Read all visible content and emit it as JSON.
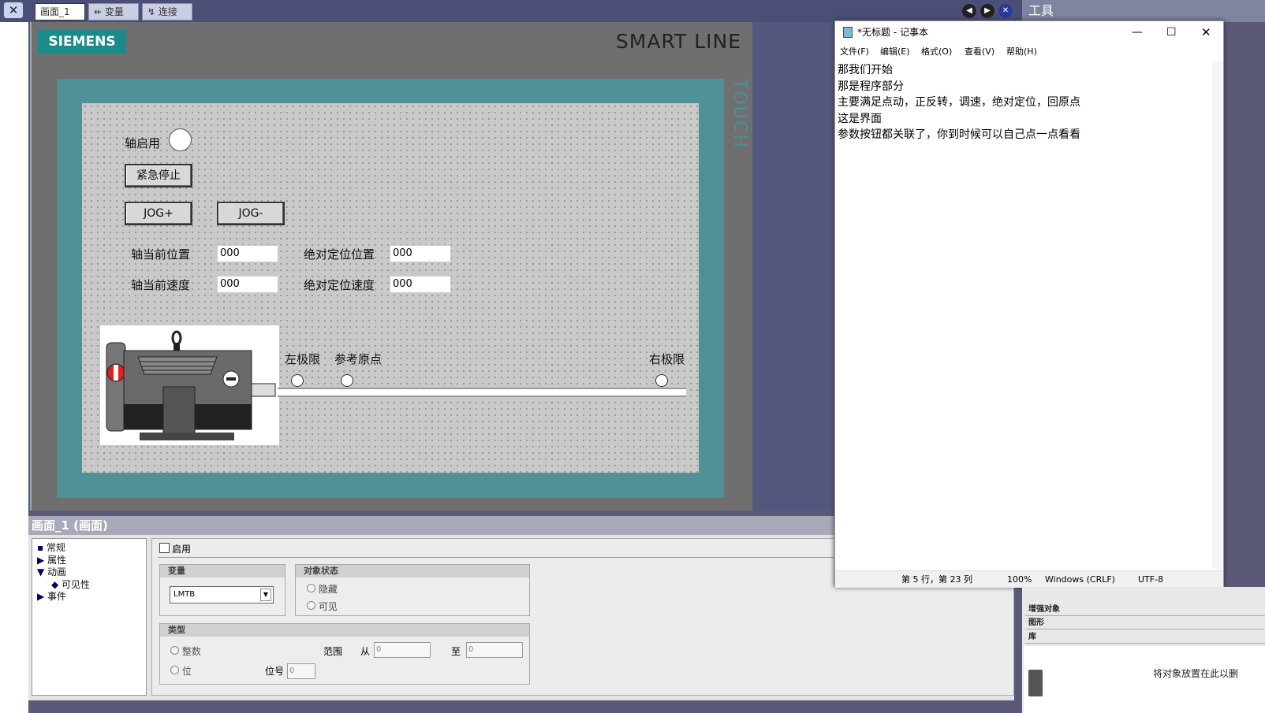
{
  "tabs": [
    {
      "label": "画面_1"
    },
    {
      "label": "变量"
    },
    {
      "label": "连接"
    }
  ],
  "tools_title": "工具",
  "hmi": {
    "brand": "SIEMENS",
    "model": "SMART LINE",
    "side_text": "TOUCH",
    "axis_enable_label": "轴启用",
    "estop_label": "紧急停止",
    "jog_plus_label": "JOG+",
    "jog_minus_label": "JOG-",
    "pos_label": "轴当前位置",
    "pos_value": "000",
    "speed_label": "轴当前速度",
    "speed_value": "000",
    "abs_pos_label": "绝对定位位置",
    "abs_pos_value": "000",
    "abs_speed_label": "绝对定位速度",
    "abs_speed_value": "000",
    "left_limit_label": "左极限",
    "home_label": "参考原点",
    "right_limit_label": "右极限"
  },
  "properties": {
    "header": "画面_1 (画面)",
    "tree": [
      {
        "label": "常规"
      },
      {
        "label": "属性"
      },
      {
        "label": "动画"
      },
      {
        "label": "可见性"
      },
      {
        "label": "事件"
      }
    ],
    "enable_label": "启用",
    "variable_group": "变量",
    "variable_value": "LMTB",
    "state_group": "对象状态",
    "state_hidden": "隐藏",
    "state_visible": "可见",
    "type_group": "类型",
    "type_integer": "整数",
    "type_bit": "位",
    "range_label": "范围",
    "from_label": "从",
    "from_value": "0",
    "to_label": "至",
    "to_value": "0",
    "bit_label": "位号",
    "bit_value": "0"
  },
  "notepad": {
    "title": "*无标题 - 记事本",
    "menu": [
      "文件(F)",
      "编辑(E)",
      "格式(O)",
      "查看(V)",
      "帮助(H)"
    ],
    "lines": [
      "那我们开始",
      "那是程序部分",
      "主要满足点动，正反转，调速，绝对定位，回原点",
      "这是界面",
      "参数按钮都关联了，你到时候可以自己点一点看看"
    ],
    "status": {
      "position": "第 5 行，第 23 列",
      "zoom": "100%",
      "line_ending": "Windows (CRLF)",
      "encoding": "UTF-8"
    }
  },
  "tools": {
    "rows": [
      "增强对象",
      "图形",
      "库"
    ],
    "drop_hint": "将对象放置在此以删"
  }
}
